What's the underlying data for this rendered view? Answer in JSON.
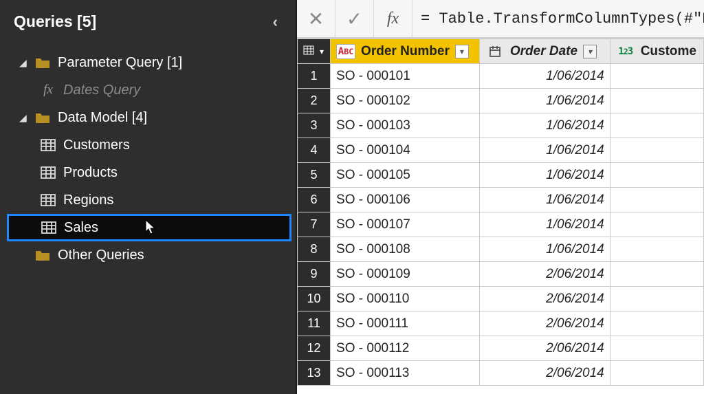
{
  "sidebar": {
    "title": "Queries [5]",
    "folders": [
      {
        "label": "Parameter Query [1]",
        "expanded": true,
        "children": [
          {
            "kind": "fx",
            "label": "Dates Query"
          }
        ]
      },
      {
        "label": "Data Model [4]",
        "expanded": true,
        "children": [
          {
            "kind": "table",
            "label": "Customers"
          },
          {
            "kind": "table",
            "label": "Products"
          },
          {
            "kind": "table",
            "label": "Regions"
          },
          {
            "kind": "table",
            "label": "Sales",
            "selected": true
          }
        ]
      },
      {
        "label": "Other Queries",
        "expanded": false,
        "children": []
      }
    ]
  },
  "formula_bar": {
    "text": "= Table.TransformColumnTypes(#\"Pro"
  },
  "grid": {
    "columns": [
      {
        "name": "Order Number",
        "type": "text"
      },
      {
        "name": "Order Date",
        "type": "date"
      },
      {
        "name": "Custome",
        "type": "number"
      }
    ],
    "rows": [
      {
        "n": 1,
        "order": "SO - 000101",
        "date": "1/06/2014"
      },
      {
        "n": 2,
        "order": "SO - 000102",
        "date": "1/06/2014"
      },
      {
        "n": 3,
        "order": "SO - 000103",
        "date": "1/06/2014"
      },
      {
        "n": 4,
        "order": "SO - 000104",
        "date": "1/06/2014"
      },
      {
        "n": 5,
        "order": "SO - 000105",
        "date": "1/06/2014"
      },
      {
        "n": 6,
        "order": "SO - 000106",
        "date": "1/06/2014"
      },
      {
        "n": 7,
        "order": "SO - 000107",
        "date": "1/06/2014"
      },
      {
        "n": 8,
        "order": "SO - 000108",
        "date": "1/06/2014"
      },
      {
        "n": 9,
        "order": "SO - 000109",
        "date": "2/06/2014"
      },
      {
        "n": 10,
        "order": "SO - 000110",
        "date": "2/06/2014"
      },
      {
        "n": 11,
        "order": "SO - 000111",
        "date": "2/06/2014"
      },
      {
        "n": 12,
        "order": "SO - 000112",
        "date": "2/06/2014"
      },
      {
        "n": 13,
        "order": "SO - 000113",
        "date": "2/06/2014"
      }
    ]
  }
}
